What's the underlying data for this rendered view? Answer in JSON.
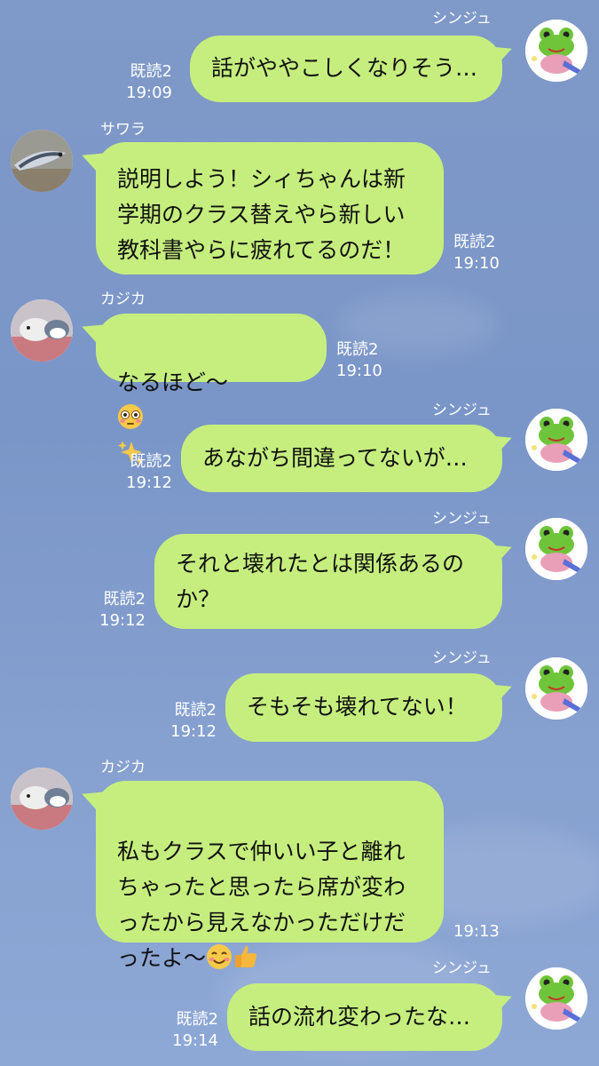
{
  "messages": [
    {
      "sender": "シンジュ",
      "side": "right",
      "text": "話がややこしくなりそう…",
      "read": "既読2",
      "time": "19:09"
    },
    {
      "sender": "サワラ",
      "side": "left",
      "text": "説明しよう！シィちゃんは新\n学期のクラス替えやら新しい\n教科書やらに疲れてるのだ！",
      "read": "既読2",
      "time": "19:10"
    },
    {
      "sender": "カジカ",
      "side": "left",
      "text": "なるほど〜",
      "read": "既読2",
      "time": "19:10"
    },
    {
      "sender": "シンジュ",
      "side": "right",
      "text": "あながち間違ってないが…",
      "read": "既読2",
      "time": "19:12"
    },
    {
      "sender": "シンジュ",
      "side": "right",
      "text": "それと壊れたとは関係あるの\nか？",
      "read": "既読2",
      "time": "19:12"
    },
    {
      "sender": "シンジュ",
      "side": "right",
      "text": "そもそも壊れてない！",
      "read": "既読2",
      "time": "19:12"
    },
    {
      "sender": "カジカ",
      "side": "left",
      "text": "私もクラスで仲いい子と離れ\nちゃったと思ったら席が変わ\nったから見えなかっただけだ\nったよ〜",
      "read": "",
      "time": "19:13"
    },
    {
      "sender": "シンジュ",
      "side": "right",
      "text": "話の流れ変わったな…",
      "read": "既読2",
      "time": "19:14"
    }
  ],
  "icons": [
    "frog-avatar-icon",
    "fish-avatar-icon",
    "seal-avatar-icon",
    "flushed-face-icon",
    "sparkles-icon",
    "smile-icon",
    "thumbs-up-icon"
  ],
  "colors": {
    "bubble": "#c6ee7e",
    "background": "#7f99c8",
    "meta_text": "#ffffff"
  }
}
